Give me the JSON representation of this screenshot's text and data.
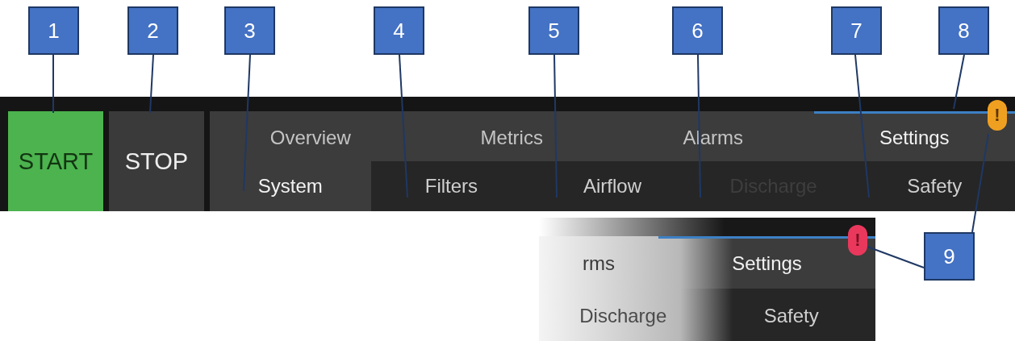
{
  "controls": [
    {
      "kind": "start",
      "label": "START",
      "active": true
    },
    {
      "kind": "stop",
      "label": "STOP",
      "active": false
    }
  ],
  "primary_tabs": [
    {
      "label": "Overview",
      "selected": false
    },
    {
      "label": "Metrics",
      "selected": false
    },
    {
      "label": "Alarms",
      "selected": false
    },
    {
      "label": "Settings",
      "selected": true,
      "badge": {
        "kind": "warning",
        "text": "!"
      }
    }
  ],
  "secondary_tabs": [
    {
      "label": "System",
      "selected": true,
      "disabled": false
    },
    {
      "label": "Filters",
      "selected": false,
      "disabled": false
    },
    {
      "label": "Airflow",
      "selected": false,
      "disabled": false
    },
    {
      "label": "Discharge",
      "selected": false,
      "disabled": true
    },
    {
      "label": "Safety",
      "selected": false,
      "disabled": false
    }
  ],
  "inset": {
    "primary_tabs": [
      {
        "label": "rms",
        "selected": false
      },
      {
        "label": "Settings",
        "selected": true,
        "badge": {
          "kind": "error",
          "text": "!"
        }
      }
    ],
    "secondary_tabs": [
      {
        "label": "Discharge",
        "selected": false,
        "disabled": true
      },
      {
        "label": "Safety",
        "selected": false,
        "disabled": false
      }
    ]
  },
  "callouts": [
    "1",
    "2",
    "3",
    "4",
    "5",
    "6",
    "7",
    "8",
    "9"
  ]
}
